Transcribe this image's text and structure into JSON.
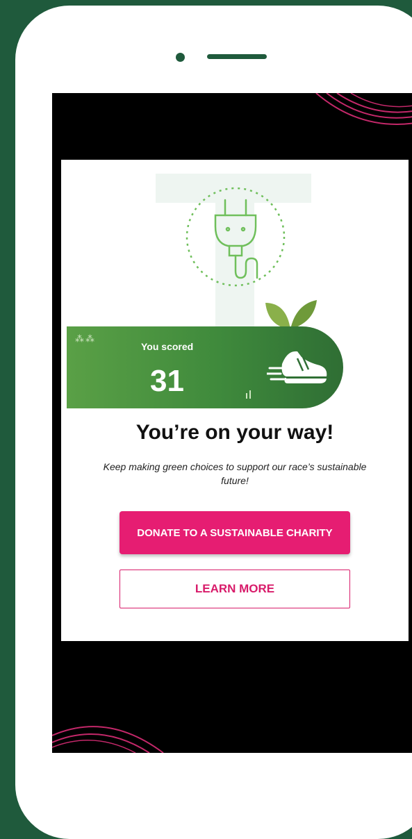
{
  "score_card": {
    "label": "You scored",
    "score": "31"
  },
  "result": {
    "headline": "You’re on your way!",
    "message": "Keep making green choices to support our race’s sustainable future!"
  },
  "actions": {
    "donate_label": "DONATE TO A SUSTAINABLE CHARITY",
    "learn_label": "LEARN MORE"
  },
  "icons": {
    "plug": "plug-icon",
    "leaves": "leaves-icon",
    "shoe": "running-shoe-icon",
    "wheat": "wheat-icon"
  },
  "colors": {
    "background": "#1f5a3c",
    "banner_green": "#4a9441",
    "accent_pink": "#e61d72",
    "side_strip": "#7aa38f"
  }
}
